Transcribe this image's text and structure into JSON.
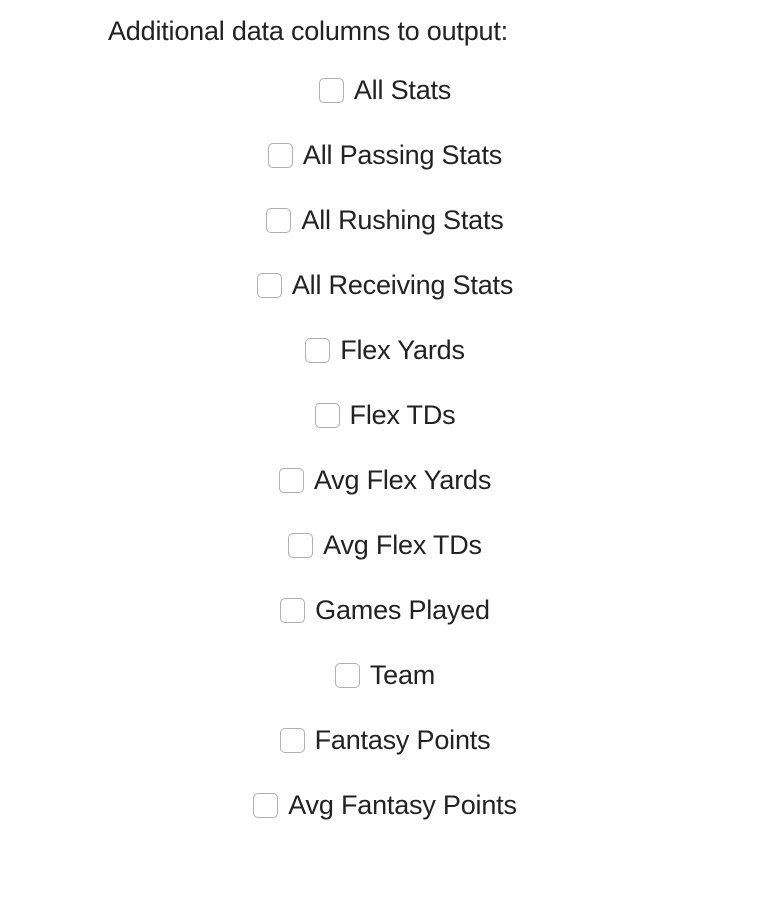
{
  "heading": "Additional data columns to output:",
  "options": [
    {
      "label": "All Stats"
    },
    {
      "label": "All Passing Stats"
    },
    {
      "label": "All Rushing Stats"
    },
    {
      "label": "All Receiving Stats"
    },
    {
      "label": "Flex Yards"
    },
    {
      "label": "Flex TDs"
    },
    {
      "label": "Avg Flex Yards"
    },
    {
      "label": "Avg Flex TDs"
    },
    {
      "label": "Games Played"
    },
    {
      "label": "Team"
    },
    {
      "label": "Fantasy Points"
    },
    {
      "label": "Avg Fantasy Points"
    }
  ]
}
